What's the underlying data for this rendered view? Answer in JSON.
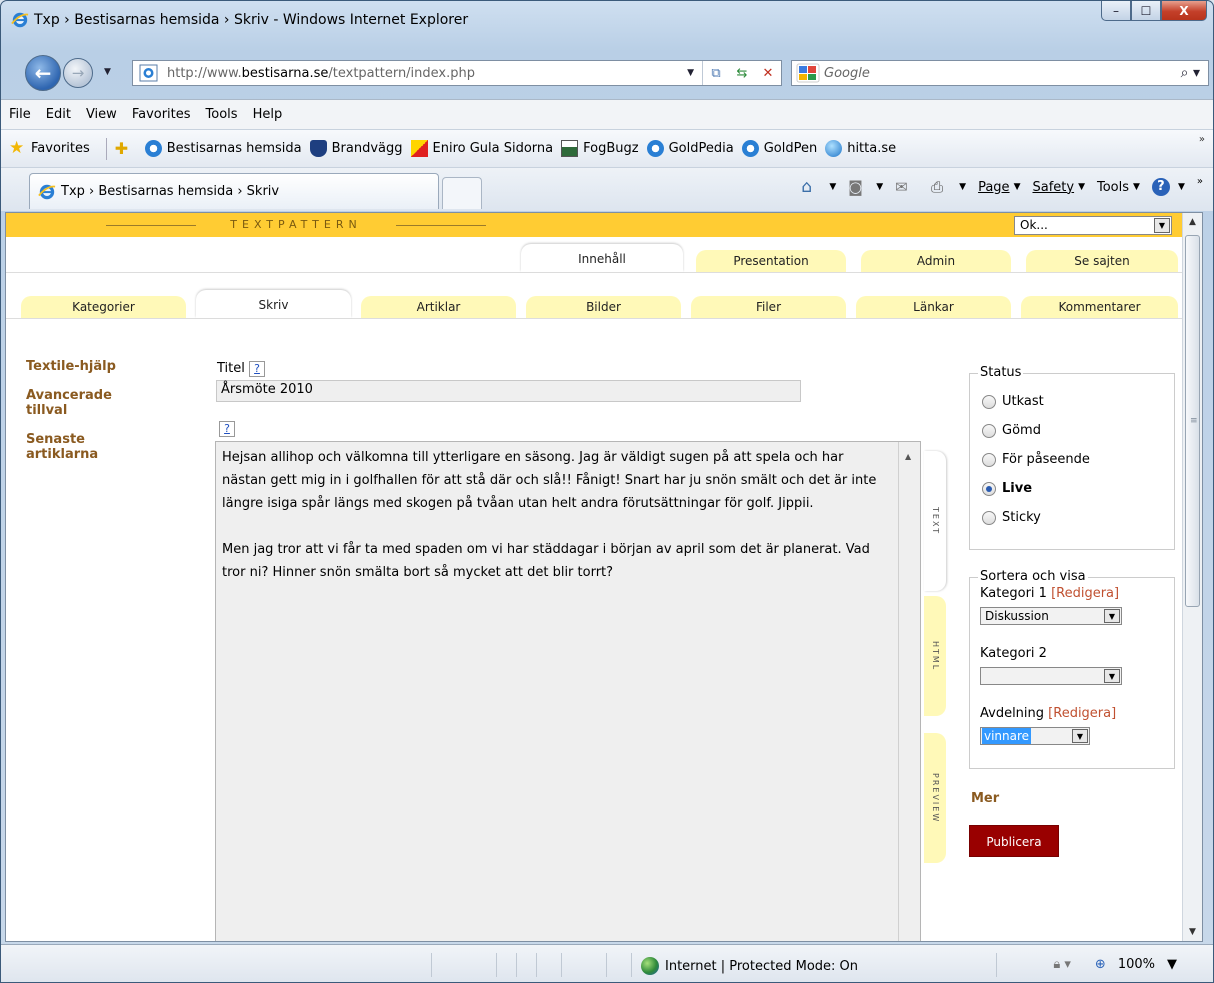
{
  "window": {
    "title": "Txp › Bestisarnas hemsida › Skriv - Windows Internet Explorer",
    "minimize": "–",
    "maximize": "☐",
    "close": "X"
  },
  "address": {
    "url_prefix": "http://www.",
    "url_domain": "bestisarna.se",
    "url_suffix": "/textpattern/index.php",
    "search_placeholder": "Google"
  },
  "menu": [
    "File",
    "Edit",
    "View",
    "Favorites",
    "Tools",
    "Help"
  ],
  "favorites": {
    "label": "Favorites",
    "links": [
      "Bestisarnas hemsida",
      "Brandvägg",
      "Eniro Gula Sidorna",
      "FogBugz",
      "GoldPedia",
      "GoldPen",
      "hitta.se"
    ]
  },
  "tab": {
    "title": "Txp › Bestisarnas hemsida › Skriv"
  },
  "commands": {
    "page": "Page",
    "safety": "Safety",
    "tools": "Tools"
  },
  "txp": {
    "logo": "TEXTPATTERN",
    "jump_select": "Ok...",
    "main_tabs": [
      "Innehåll",
      "Presentation",
      "Admin",
      "Se sajten"
    ],
    "sub_tabs": [
      "Kategorier",
      "Skriv",
      "Artiklar",
      "Bilder",
      "Filer",
      "Länkar",
      "Kommentarer"
    ],
    "left_nav": [
      "Textile-hjälp",
      "Avancerade tillval",
      "Senaste artiklarna"
    ],
    "help_mark": "?",
    "title_label": "Titel",
    "title_value": "Årsmöte 2010",
    "body_p1": "Hejsan allihop och välkomna till ytterligare en säsong. Jag är väldigt sugen på att spela och har nästan gett mig in i golfhallen för att stå där och slå!! Fånigt! Snart har ju snön smält och det är inte längre isiga spår längs med skogen på tvåan utan helt andra förutsättningar för golf. Jippii.",
    "body_p2": "Men jag tror att vi får ta med spaden om vi har städdagar i början av april som det är planerat. Vad tror ni? Hinner snön smälta bort så mycket att det blir torrt?",
    "side_tabs": [
      "TEXT",
      "HTML",
      "PREVIEW"
    ],
    "status_legend": "Status",
    "status_options": [
      "Utkast",
      "Gömd",
      "För påseende",
      "Live",
      "Sticky"
    ],
    "sort_legend": "Sortera och visa",
    "cat1_label": "Kategori 1",
    "edit_label": "[Redigera]",
    "cat1_value": "Diskussion",
    "cat2_label": "Kategori 2",
    "cat2_value": "",
    "section_label": "Avdelning",
    "section_value": "vinnare",
    "more": "Mer",
    "publish": "Publicera"
  },
  "status": {
    "zone": "Internet | Protected Mode: On",
    "zoom": "100%"
  }
}
